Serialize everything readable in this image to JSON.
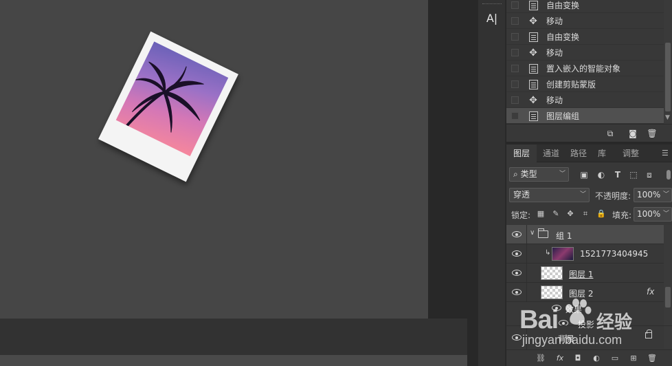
{
  "canvas": {
    "photo_colors": {
      "sky_top": "#6a61b8",
      "sky_bottom": "#f6879c",
      "frame": "#f4f4f4"
    }
  },
  "toolbar": {
    "text_tool_label": "A|"
  },
  "history": {
    "items": [
      {
        "label": "自由变换",
        "icon": "document-icon"
      },
      {
        "label": "移动",
        "icon": "move-icon"
      },
      {
        "label": "自由变换",
        "icon": "document-icon"
      },
      {
        "label": "移动",
        "icon": "move-icon"
      },
      {
        "label": "置入嵌入的智能对象",
        "icon": "document-icon"
      },
      {
        "label": "创建剪贴蒙版",
        "icon": "document-icon"
      },
      {
        "label": "移动",
        "icon": "move-icon"
      },
      {
        "label": "图层编组",
        "icon": "document-icon",
        "active": true
      }
    ]
  },
  "layers_panel": {
    "tabs": [
      "图层",
      "通道",
      "路径",
      "库",
      "调整"
    ],
    "active_tab": "图层",
    "filter_kind": "类型",
    "blend_mode": "穿透",
    "opacity_label": "不透明度:",
    "opacity_value": "100%",
    "lock_label": "锁定:",
    "fill_label": "填充:",
    "fill_value": "100%",
    "layers": {
      "group": "组 1",
      "smart_object": "1521773404945",
      "layer1": "图层 1",
      "layer2": "图层 2",
      "effects": "效果",
      "shadow": "投影",
      "background": "背景"
    },
    "fx_badge": "fx"
  },
  "watermark": {
    "logo": "Bai",
    "brand": "经验",
    "url": "jingyan.baidu.com"
  }
}
